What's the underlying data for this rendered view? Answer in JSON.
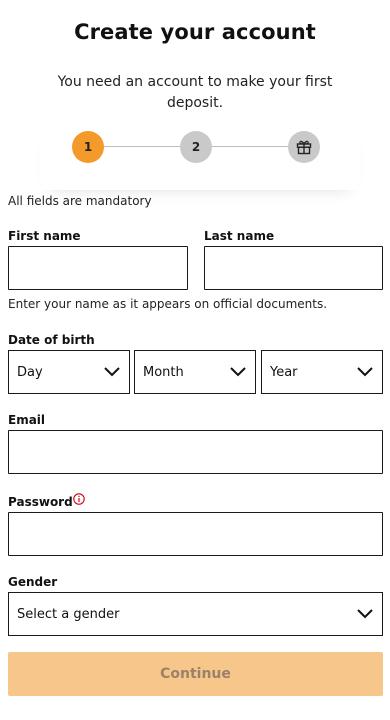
{
  "page": {
    "title": "Create your account",
    "subtitle": "You need an account to make your first deposit."
  },
  "stepper": {
    "steps": [
      {
        "label": "1",
        "state": "active"
      },
      {
        "label": "2",
        "state": "inactive"
      },
      {
        "label": "",
        "state": "inactive",
        "icon": "gift-icon"
      }
    ],
    "active_color": "#f39a2a",
    "inactive_color": "#c9c9c9"
  },
  "form": {
    "mandatory_note": "All fields are mandatory",
    "first_name": {
      "label": "First name",
      "value": ""
    },
    "last_name": {
      "label": "Last name",
      "value": ""
    },
    "name_hint": "Enter your name as it appears on official documents.",
    "dob": {
      "label": "Date of birth",
      "day": "Day",
      "month": "Month",
      "year": "Year"
    },
    "email": {
      "label": "Email",
      "value": ""
    },
    "password": {
      "label": "Password",
      "value": "",
      "info_icon": "info-icon",
      "info_color": "#d0021b"
    },
    "gender": {
      "label": "Gender",
      "selected": "Select a gender"
    },
    "continue_label": "Continue",
    "continue_color": "#f7c68a"
  }
}
